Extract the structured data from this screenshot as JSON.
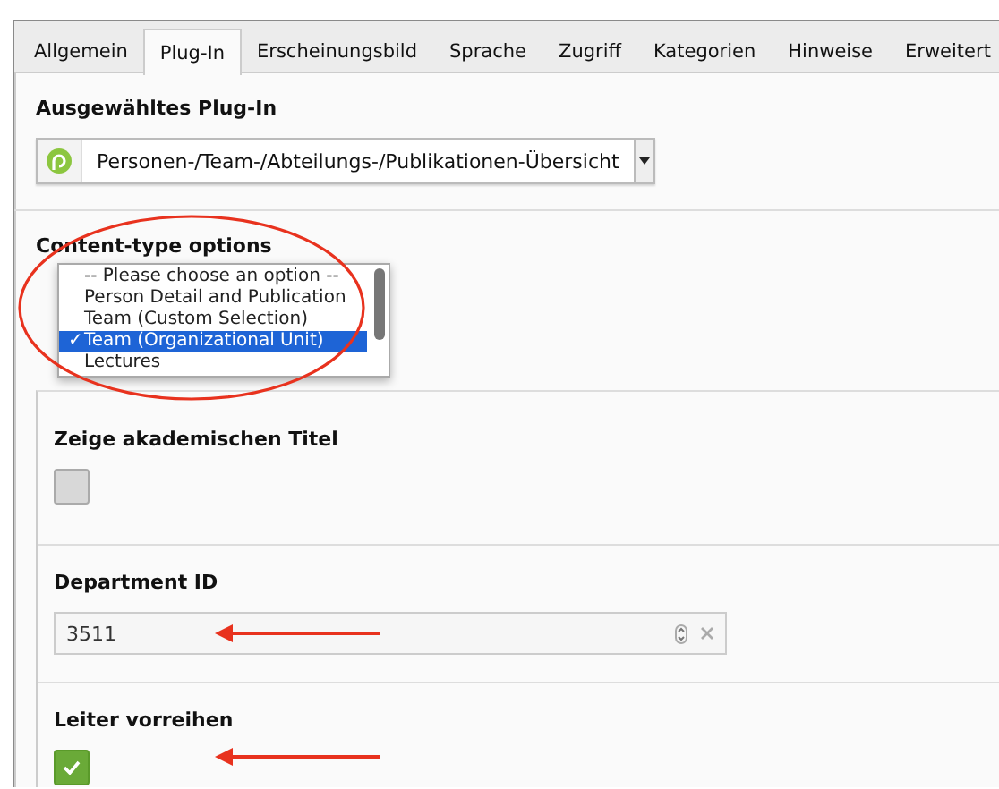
{
  "tabs": [
    {
      "label": "Allgemein",
      "selected": false
    },
    {
      "label": "Plug-In",
      "selected": true
    },
    {
      "label": "Erscheinungsbild",
      "selected": false
    },
    {
      "label": "Sprache",
      "selected": false
    },
    {
      "label": "Zugriff",
      "selected": false
    },
    {
      "label": "Kategorien",
      "selected": false
    },
    {
      "label": "Hinweise",
      "selected": false
    },
    {
      "label": "Erweitert",
      "selected": false
    }
  ],
  "plugin": {
    "label": "Ausgewähltes Plug-In",
    "value": "Personen-/Team-/Abteilungs-/Publikationen-Übersicht"
  },
  "content_type": {
    "label": "Content-type options",
    "options": [
      {
        "label": "-- Please choose an option --",
        "selected": false
      },
      {
        "label": "Person Detail and Publication",
        "selected": false
      },
      {
        "label": "Team (Custom Selection)",
        "selected": false
      },
      {
        "label": "Team (Organizational Unit)",
        "selected": true,
        "mark": "✓"
      },
      {
        "label": "Lectures",
        "selected": false
      }
    ]
  },
  "fields": [
    {
      "kind": "checkbox",
      "label": "Zeige akademischen Titel",
      "checked": false
    },
    {
      "kind": "number",
      "label": "Department ID",
      "value": "3511"
    },
    {
      "kind": "checkbox",
      "label": "Leiter vorreihen",
      "checked": true
    }
  ]
}
